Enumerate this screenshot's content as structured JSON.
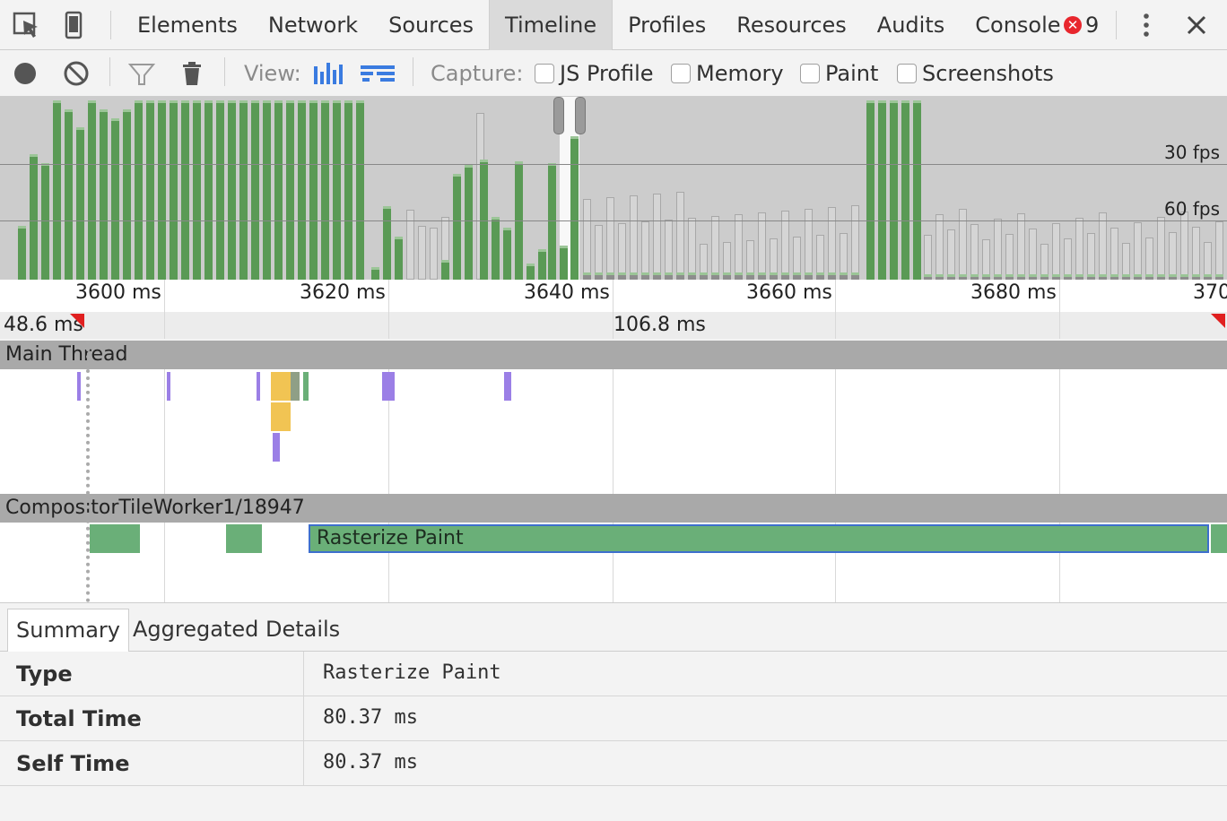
{
  "tabbar": {
    "tabs": [
      "Elements",
      "Network",
      "Sources",
      "Timeline",
      "Profiles",
      "Resources",
      "Audits",
      "Console"
    ],
    "active_tab": "Timeline",
    "error_count": "9"
  },
  "toolbar": {
    "view_label": "View:",
    "capture_label": "Capture:",
    "checkboxes": [
      {
        "label": "JS Profile",
        "checked": false
      },
      {
        "label": "Memory",
        "checked": false
      },
      {
        "label": "Paint",
        "checked": false
      },
      {
        "label": "Screenshots",
        "checked": false
      }
    ]
  },
  "overview": {
    "fps_30": "30 fps",
    "fps_60": "60 fps"
  },
  "ruler": {
    "ticks": [
      "3600 ms",
      "3620 ms",
      "3640 ms",
      "3660 ms",
      "3680 ms",
      "370"
    ]
  },
  "frames": {
    "first": "48.6 ms",
    "second": "106.8 ms"
  },
  "threads": {
    "main": "Main Thread",
    "compositor": "CompositorTileWorker1/18947"
  },
  "selected_event": "Rasterize Paint",
  "details": {
    "tabs": [
      "Summary",
      "Aggregated Details"
    ],
    "rows": [
      {
        "key": "Type",
        "value": "Rasterize Paint"
      },
      {
        "key": "Total Time",
        "value": "80.37 ms"
      },
      {
        "key": "Self Time",
        "value": "80.37 ms"
      }
    ]
  },
  "colors": {
    "rendering": "#9b7fe6",
    "scripting": "#f1c453",
    "painting": "#6aaf78",
    "selection": "#3d6fcd",
    "overview_bg": "#cccccc"
  }
}
